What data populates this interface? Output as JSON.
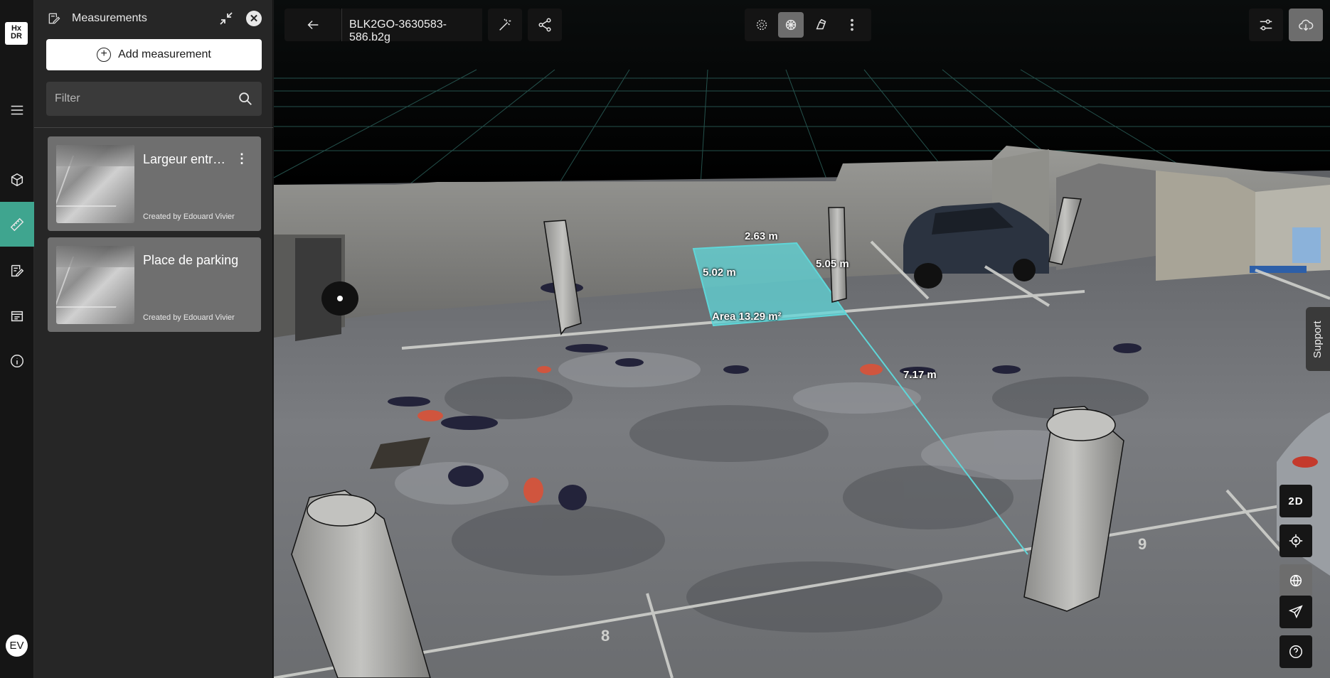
{
  "app": {
    "logo_text": "Hx DR",
    "avatar_initials": "EV"
  },
  "rail": {
    "items": [
      {
        "name": "menu-icon"
      },
      {
        "name": "cube-icon"
      },
      {
        "name": "ruler-icon",
        "active": true
      },
      {
        "name": "annotation-icon"
      },
      {
        "name": "report-icon"
      },
      {
        "name": "info-icon"
      }
    ]
  },
  "panel": {
    "title": "Measurements",
    "add_label": "Add measurement",
    "filter_placeholder": "Filter",
    "measurements": [
      {
        "name": "Largeur entr…",
        "created_by": "Created by Edouard Vivier"
      },
      {
        "name": "Place de parking",
        "created_by": "Created by Edouard Vivier"
      }
    ]
  },
  "toolbar": {
    "file_name": "BLK2GO-3630583-586.b2g",
    "view_modes": [
      "point-cloud-icon",
      "mesh-icon",
      "render-icon"
    ],
    "active_view_mode": "mesh-icon"
  },
  "scene_labels": {
    "top_edge": "2.63 m",
    "left_edge": "5.02 m",
    "right_edge": "5.05 m",
    "area": "Area 13.29 m²",
    "distance": "7.17 m"
  },
  "right_controls": {
    "mode_2d": "2D",
    "support": "Support"
  },
  "colors": {
    "accent": "#3fa58f",
    "measurement_fill": "#5fd6d8"
  }
}
